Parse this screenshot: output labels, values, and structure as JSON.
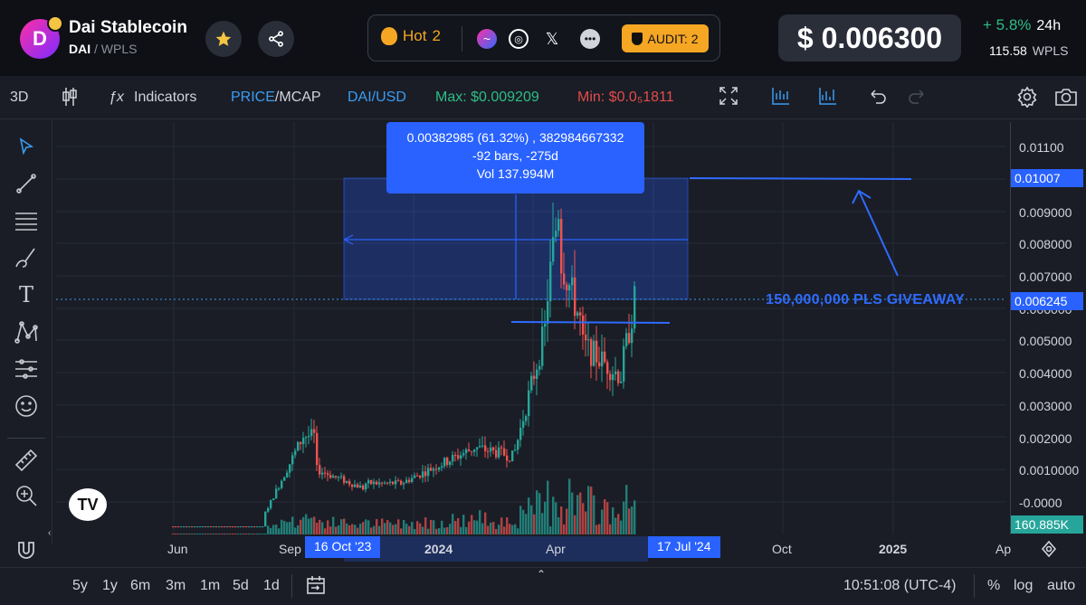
{
  "header": {
    "token_name": "Dai Stablecoin",
    "pair_base": "DAI",
    "pair_quote": "WPLS",
    "hot_label": "Hot",
    "hot_count": "2",
    "audit_label": "AUDIT: 2",
    "price": "$ 0.006300",
    "change": "+ 5.8%",
    "change_period": "24h",
    "volume_value": "115.58",
    "volume_unit": "WPLS"
  },
  "toolbar": {
    "view_3d": "3D",
    "indicators": "Indicators",
    "price_label": "PRICE",
    "mcap_label": "MCAP",
    "pair": "DAI/USD",
    "max": "Max: $0.009209",
    "min": "Min: $0.0₅1811"
  },
  "tooltip": {
    "line1": "0.00382985 (61.32%) , 382984667332",
    "line2": "-92 bars, -275d",
    "line3": "Vol 137.994M"
  },
  "annotation": "150,000,000 PLS GIVEAWAY",
  "y_axis": {
    "labels": [
      "0.01100",
      "0.009000",
      "0.008000",
      "0.007000",
      "0.005000",
      "0.004000",
      "0.003000",
      "0.002000",
      "0.0010000",
      "-0.0000"
    ],
    "tag_range_top": "0.01007",
    "tag_current": "0.006245",
    "tag_partial": "0.006000",
    "tag_volume": "160.885K"
  },
  "x_axis": {
    "labels": [
      "Jun",
      "Sep",
      "2024",
      "Apr",
      "Oct",
      "2025",
      "Ap"
    ],
    "range_start": "16 Oct '23",
    "range_end": "17 Jul '24"
  },
  "bottom": {
    "ranges": [
      "5y",
      "1y",
      "6m",
      "3m",
      "1m",
      "5d",
      "1d"
    ],
    "time": "10:51:08 (UTC-4)",
    "percent": "%",
    "log": "log",
    "auto": "auto"
  },
  "colors": {
    "up": "#26a69a",
    "down": "#ef5350",
    "accent": "#2962ff",
    "max_green": "#2ebd85",
    "min_red": "#e24c4c"
  }
}
